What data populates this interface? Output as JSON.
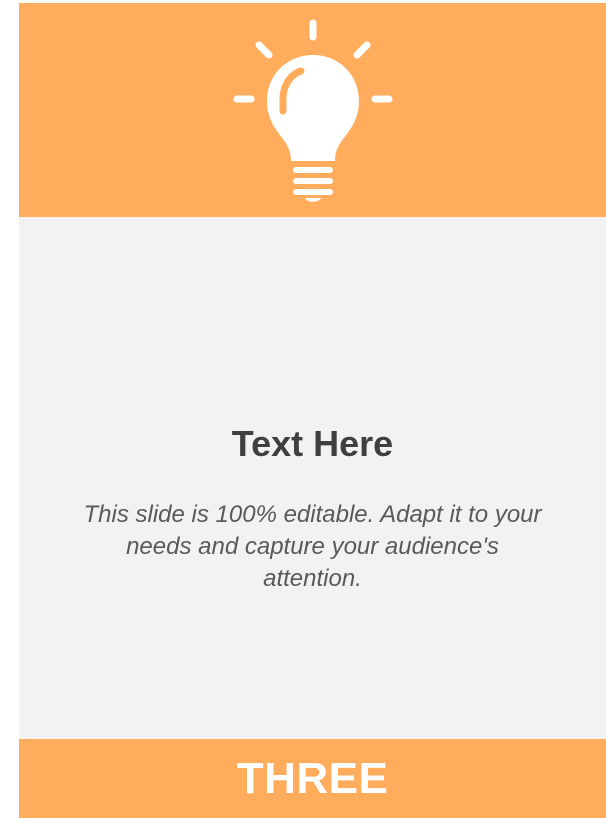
{
  "card": {
    "icon": "lightbulb-icon",
    "title": "Text Here",
    "description": "This slide is 100% editable. Adapt it to your needs and capture your audience's attention.",
    "label": "THREE"
  },
  "colors": {
    "accent": "#FFAD5C",
    "panel": "#F2F2F2",
    "title": "#3F3F3F",
    "description": "#595959",
    "icon": "#FFFFFF"
  }
}
